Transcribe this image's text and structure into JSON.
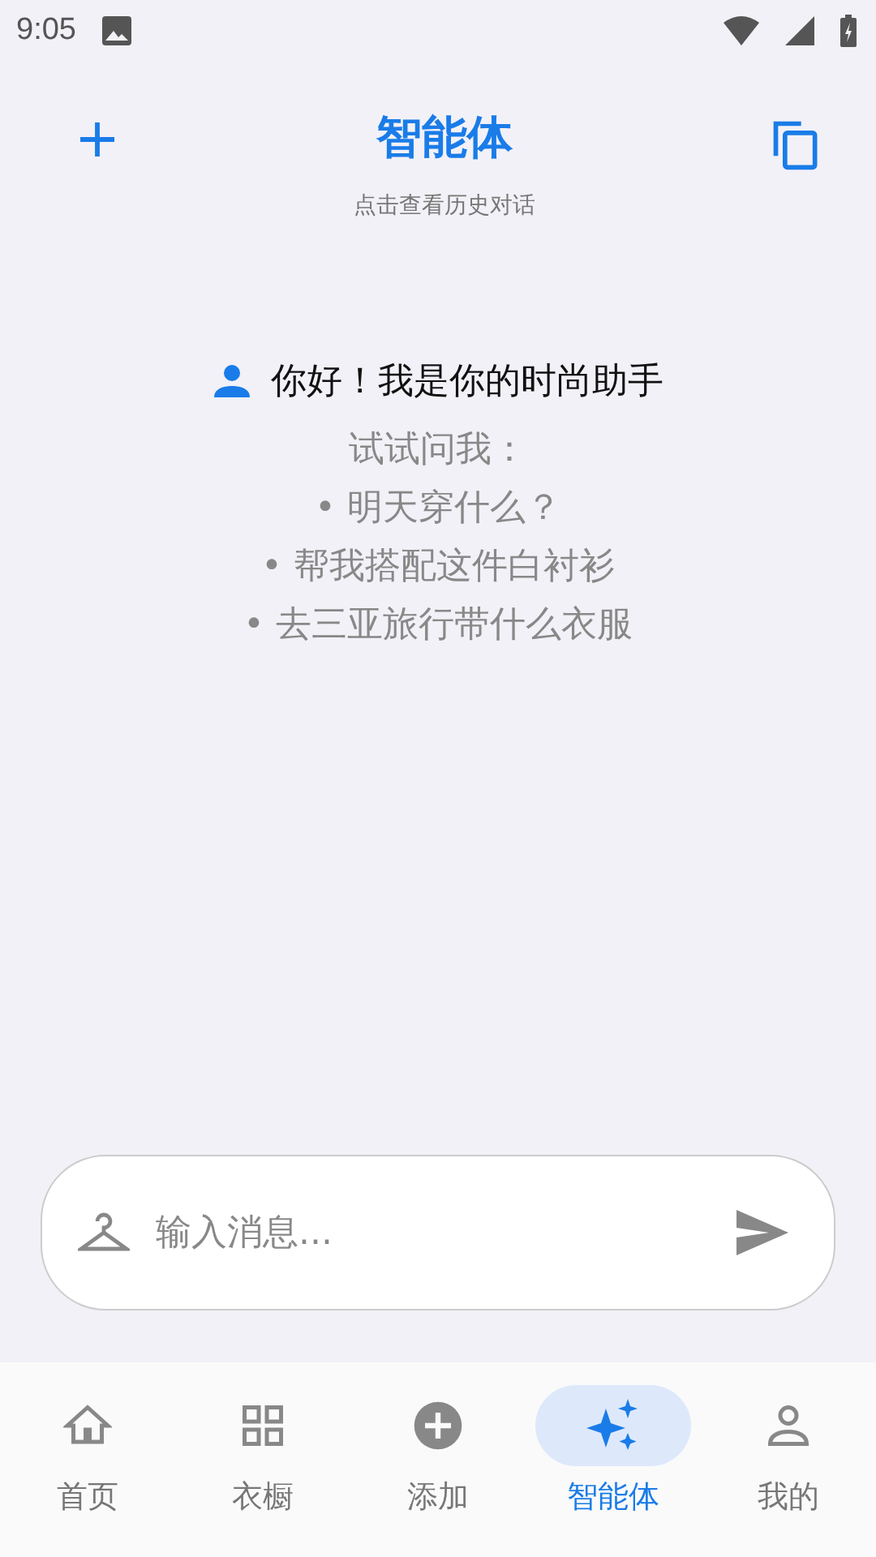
{
  "status_bar": {
    "time": "9:05"
  },
  "header": {
    "title": "智能体",
    "subtitle": "点击查看历史对话"
  },
  "greeting": "你好！我是你的时尚助手",
  "suggestions": [
    "试试问我：",
    "• 明天穿什么？",
    "• 帮我搭配这件白衬衫",
    "• 去三亚旅行带什么衣服"
  ],
  "input": {
    "placeholder": "输入消息..."
  },
  "nav": [
    {
      "label": "首页",
      "selected": false
    },
    {
      "label": "衣橱",
      "selected": false
    },
    {
      "label": "添加",
      "selected": false
    },
    {
      "label": "智能体",
      "selected": true
    },
    {
      "label": "我的",
      "selected": false
    }
  ]
}
